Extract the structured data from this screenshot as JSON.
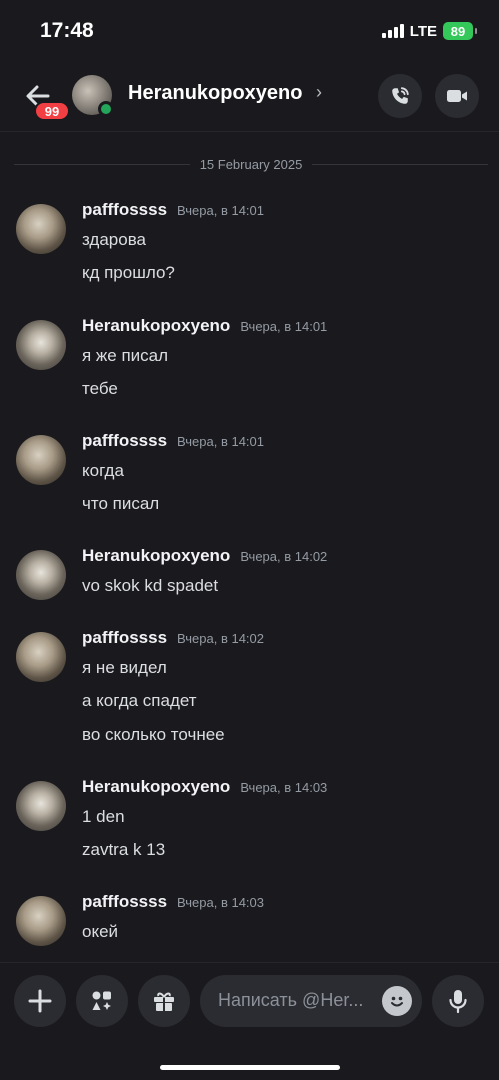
{
  "status_bar": {
    "time": "17:48",
    "network": "LTE",
    "battery": "89"
  },
  "header": {
    "title": "Heranukopoxyeno",
    "chevron": "›",
    "unread_count": "99",
    "icons": {
      "back": "arrow-left-icon",
      "call": "phone-call-icon",
      "video": "video-camera-icon"
    }
  },
  "date_divider": "15 February 2025",
  "messages": [
    {
      "author": "pafffossss",
      "time": "Вчера, в 14:01",
      "lines": [
        "здарова",
        "кд прошло?"
      ]
    },
    {
      "author": "Heranukopoxyeno",
      "time": "Вчера, в 14:01",
      "lines": [
        "я же писал",
        "тебе"
      ]
    },
    {
      "author": "pafffossss",
      "time": "Вчера, в 14:01",
      "lines": [
        "когда",
        "что писал"
      ]
    },
    {
      "author": "Heranukopoxyeno",
      "time": "Вчера, в 14:02",
      "lines": [
        "vo skok kd spadet"
      ]
    },
    {
      "author": "pafffossss",
      "time": "Вчера, в 14:02",
      "lines": [
        "я не видел",
        "а когда спадет",
        "во сколько точнее"
      ]
    },
    {
      "author": "Heranukopoxyeno",
      "time": "Вчера, в 14:03",
      "lines": [
        "1 den",
        "zavtra k 13"
      ]
    },
    {
      "author": "pafffossss",
      "time": "Вчера, в 14:03",
      "lines": [
        "окей"
      ]
    }
  ],
  "composer": {
    "placeholder": "Написать @Her...",
    "icons": {
      "plus": "plus-icon",
      "apps": "apps-icon",
      "gift": "gift-icon",
      "emoji": "emoji-icon",
      "mic": "microphone-icon"
    }
  }
}
